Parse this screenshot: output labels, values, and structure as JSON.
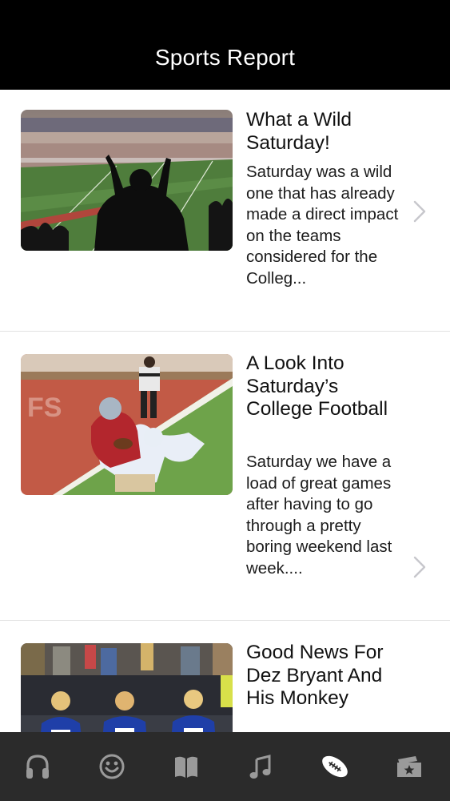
{
  "nav": {
    "title": "Sports Report"
  },
  "articles": [
    {
      "headline": "What a Wild Saturday!",
      "summary": "Saturday was a wild one that has already made a direct impact on the teams considered for the Colleg...",
      "image": "stadium-crowd-photo"
    },
    {
      "headline": "A Look Into Saturday’s College Football",
      "summary": "Saturday we have a load of great games after having to go through a pretty boring weekend last week....",
      "image": "football-catch-photo"
    },
    {
      "headline": "Good News For Dez Bryant And His Monkey",
      "summary": "",
      "image": "cheerleaders-photo"
    }
  ],
  "tabs": [
    {
      "icon": "headphones-icon"
    },
    {
      "icon": "smiley-icon"
    },
    {
      "icon": "book-icon"
    },
    {
      "icon": "music-note-icon"
    },
    {
      "icon": "football-icon",
      "selected": true
    },
    {
      "icon": "ticket-star-icon"
    }
  ],
  "colors": {
    "nav_bg": "#000000",
    "tab_bar_bg": "#2b2b2b",
    "tab_icon": "#9a9a9a",
    "tab_icon_selected": "#ffffff"
  }
}
